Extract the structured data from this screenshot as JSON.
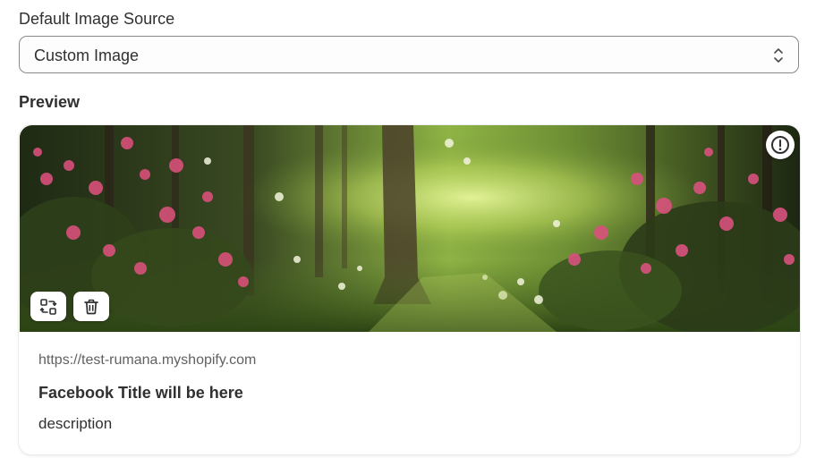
{
  "form": {
    "source_label": "Default Image Source",
    "source_value": "Custom Image",
    "preview_heading": "Preview"
  },
  "preview_card": {
    "url": "https://test-rumana.myshopify.com",
    "title": "Facebook Title will be here",
    "description": "description",
    "image": "forest-path-with-pink-flowers",
    "buttons": {
      "warning_icon": "exclamation-circle-icon",
      "replace_icon": "image-replace-icon",
      "delete_icon": "trash-icon"
    }
  },
  "colors": {
    "text": "#303030",
    "subdued_text": "#616161",
    "border": "#8a8a8a"
  }
}
